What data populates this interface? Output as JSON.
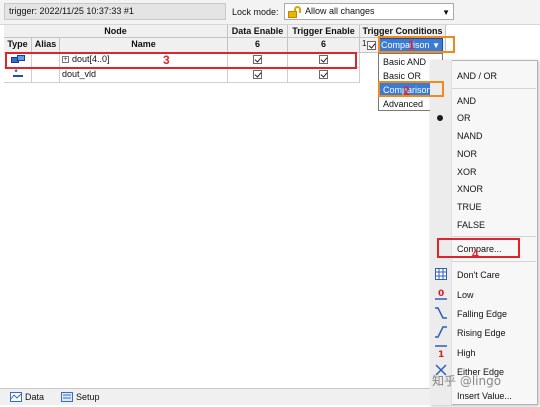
{
  "topbar": {
    "trigger_label": "trigger: 2022/11/25 10:37:33  #1",
    "lock_mode_label": "Lock mode:",
    "lock_mode_value": "Allow all changes"
  },
  "table": {
    "group_node": "Node",
    "group_data_enable": "Data Enable",
    "group_trigger_enable": "Trigger Enable",
    "group_trigger_conditions": "Trigger Conditions",
    "col_type": "Type",
    "col_alias": "Alias",
    "col_name": "Name",
    "data_enable_count": "6",
    "trigger_enable_count": "6",
    "condition_index": "1",
    "rows": [
      {
        "name": "dout[4..0]",
        "expand": "+"
      },
      {
        "name": "dout_vld"
      }
    ]
  },
  "condition_combo": {
    "value": "Comparison"
  },
  "condition_options": [
    "Basic AND",
    "Basic OR",
    "Comparison",
    "Advanced"
  ],
  "context_menu": {
    "and_or": "AND / OR",
    "logic": [
      "AND",
      "OR",
      "NAND",
      "NOR",
      "XOR",
      "XNOR",
      "TRUE",
      "FALSE"
    ],
    "selected_logic": "OR",
    "compare": "Compare...",
    "conditions": [
      "Don't Care",
      "Low",
      "Falling Edge",
      "Rising Edge",
      "High",
      "Either Edge",
      "Insert Value..."
    ]
  },
  "annotations": {
    "n1": "1",
    "n2": "2",
    "n3": "3",
    "n4": "4"
  },
  "bottom_tabs": [
    "Data",
    "Setup"
  ],
  "watermark": "知乎 @lingo",
  "colors": {
    "selection": "#3a7bd5",
    "annotation_red": "#e0252a",
    "annotation_orange": "#f08a1c"
  }
}
